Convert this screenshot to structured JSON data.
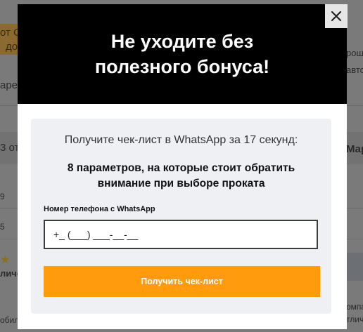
{
  "background": {
    "fragments": [
      {
        "text": "от С"
      },
      {
        "text": "до"
      },
      {
        "text": "аре"
      },
      {
        "text": "3 от"
      },
      {
        "text": "9"
      },
      {
        "text": "5"
      },
      {
        "text": "личе."
      },
      {
        "text": "обил"
      },
      {
        "text": "рош"
      },
      {
        "text": "авто"
      },
      {
        "text": "Мар"
      },
      {
        "text": "омпа"
      },
      {
        "text": "тличн"
      }
    ]
  },
  "modal": {
    "title": "Не уходите без полезного бонуса!",
    "close_icon": "close-icon",
    "card": {
      "subtitle": "Получите чек-лист в WhatsApp за 17 секунд:",
      "bold_text": "8 параметров, на которые стоит обратить внимание при выборе проката",
      "phone_label": "Номер телефона с WhatsApp",
      "phone_placeholder": "+_ (___) ___-__-__",
      "submit_label": "Получить чек-лист"
    }
  },
  "colors": {
    "header_bg": "#000000",
    "accent": "#ff9b0c",
    "card_bg": "#eef0f4"
  }
}
